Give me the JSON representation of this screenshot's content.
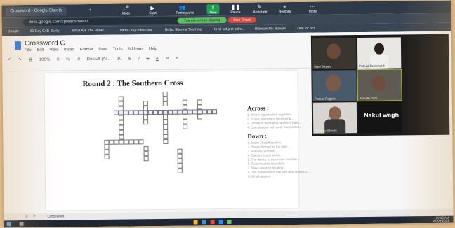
{
  "browser": {
    "tabs": [
      {
        "label": "Crossword - Google Sheets"
      },
      {
        "label": "+"
      }
    ],
    "url": "docs.google.com/spreadsheets/...",
    "bookmarks": [
      "Google",
      "90 Day CAE Study",
      "What Are The Benef...",
      "Meet - xqy-mkbs-iaa",
      "Nisha Sharma Teaching",
      "Hit all subject colle...",
      "Ultimate Nik Speaks",
      "Zeal for Sci...",
      "Google Analyti..."
    ],
    "zoom_controls": {
      "mute": "Mute",
      "video": "Start Video",
      "participants": "Participants",
      "participants_count": "7",
      "new_share": "New Share",
      "pause_share": "Pause Share",
      "annotate": "Annotate",
      "remote_control": "Remote Control",
      "more": "More",
      "sharing_notice": "You are screen sharing",
      "stop_share": "Stop Share"
    }
  },
  "doc": {
    "title": "Crossword G",
    "menu": [
      "File",
      "Edit",
      "View",
      "Insert",
      "Format",
      "Data",
      "Tools",
      "Add-ons",
      "Help"
    ],
    "toolbar": [
      "↶",
      "↷",
      "🖶",
      "100%",
      "$",
      "%",
      ".0",
      "Default (Ar...",
      "10",
      "B",
      "I",
      "S",
      "A",
      "⊞",
      "≡"
    ],
    "heading": "Round 2 : The Southern Cross",
    "across_title": "Across :",
    "across_clues": [
      "1. Which organisation regulates...",
      "2. Shock endurance measuring...",
      "3. Similarity belonging to which Table...",
      "4. Combination with work transmitted..."
    ],
    "down_title": "Down :",
    "down_clues": [
      "1. Study of earthquakes...",
      "2. Shape formed as the river ...",
      "3. Volcanic eruption...",
      "4. Sulphur lies in which...",
      "5. The device to determine position...",
      "6. Tectonic plate boundary...",
      "7. Wave used for locating...",
      "8. The natural force that can give displaced ...",
      "9. Which planet ..."
    ],
    "sheet_tab": "Crossword"
  },
  "gallery": {
    "participants": [
      {
        "name": "Ngai Bayate"
      },
      {
        "name": "Pubuja Deshmukh"
      },
      {
        "name": "Pranav Pagare"
      },
      {
        "name": "Aniketh Patil"
      },
      {
        "name": "PRAnav Shinde"
      },
      {
        "name": "Nakul wagh"
      }
    ]
  },
  "taskbar": {
    "time": "10:15 AM",
    "date": "24-06-2021"
  },
  "colors": {
    "share_green": "#1f9d55",
    "stop_red": "#d93025",
    "active_speaker": "#c6e24a",
    "docs_blue": "#2b7de9"
  }
}
